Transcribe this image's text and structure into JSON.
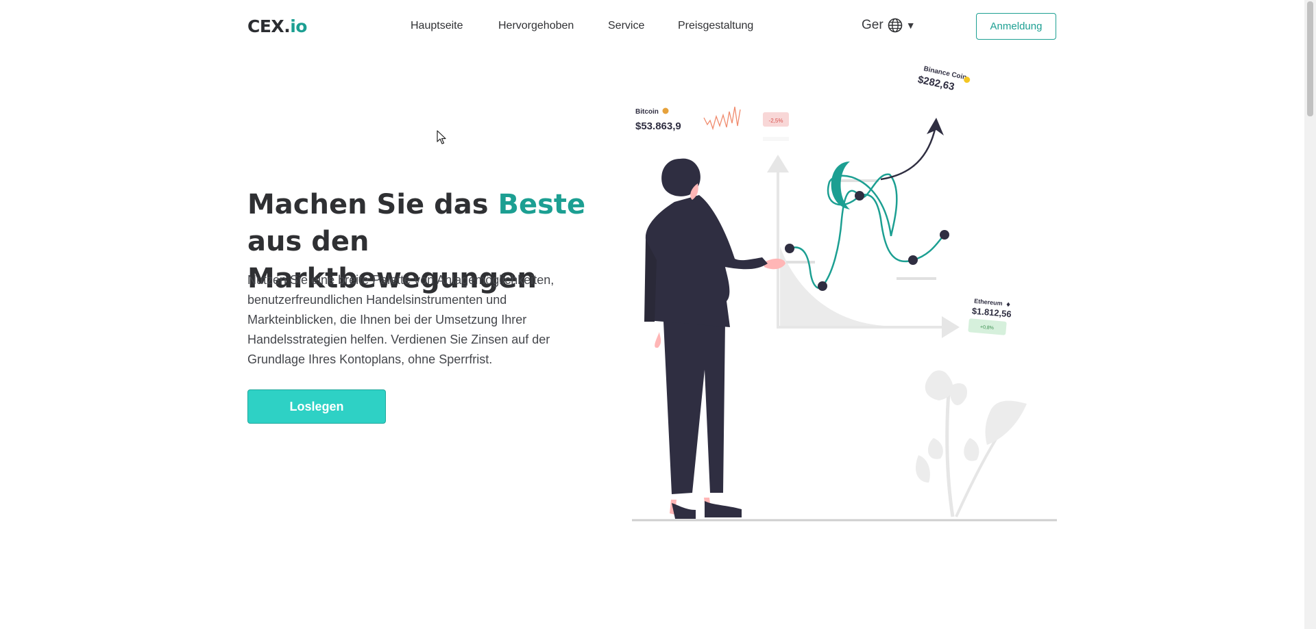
{
  "header": {
    "logo_main": "CEX.",
    "logo_accent": "io",
    "nav": [
      "Hauptseite",
      "Hervorgehoben",
      "Service",
      "Preisgestaltung"
    ],
    "language": "Ger",
    "login_label": "Anmeldung"
  },
  "hero": {
    "title_part1": "Machen Sie das ",
    "title_highlight": "Beste",
    "title_part2": " aus den Marktbewegungen",
    "description": "Nutzen Sie eine breite Palette von Anlagemöglichkeiten, benutzerfreundlichen Handelsinstrumenten und Markteinblicken, die Ihnen bei der Umsetzung Ihrer Handelsstrategien helfen. Verdienen Sie Zinsen auf der Grundlage Ihres Kontoplans, ohne Sperrfrist.",
    "cta_label": "Loslegen"
  },
  "illustration": {
    "bitcoin": {
      "name": "Bitcoin",
      "price": "$53.863,9",
      "change": "-2,5%"
    },
    "binance": {
      "name": "Binance Coin",
      "price": "$282,63"
    },
    "ethereum": {
      "name": "Ethereum",
      "price": "$1.812,56",
      "change": "+0,8%"
    }
  },
  "colors": {
    "accent": "#1c9f92",
    "cta": "#2ed1c5",
    "text": "#2f3033",
    "figure": "#2f2e41",
    "negative": "#f8d7d7",
    "positive": "#d6f0dc"
  }
}
